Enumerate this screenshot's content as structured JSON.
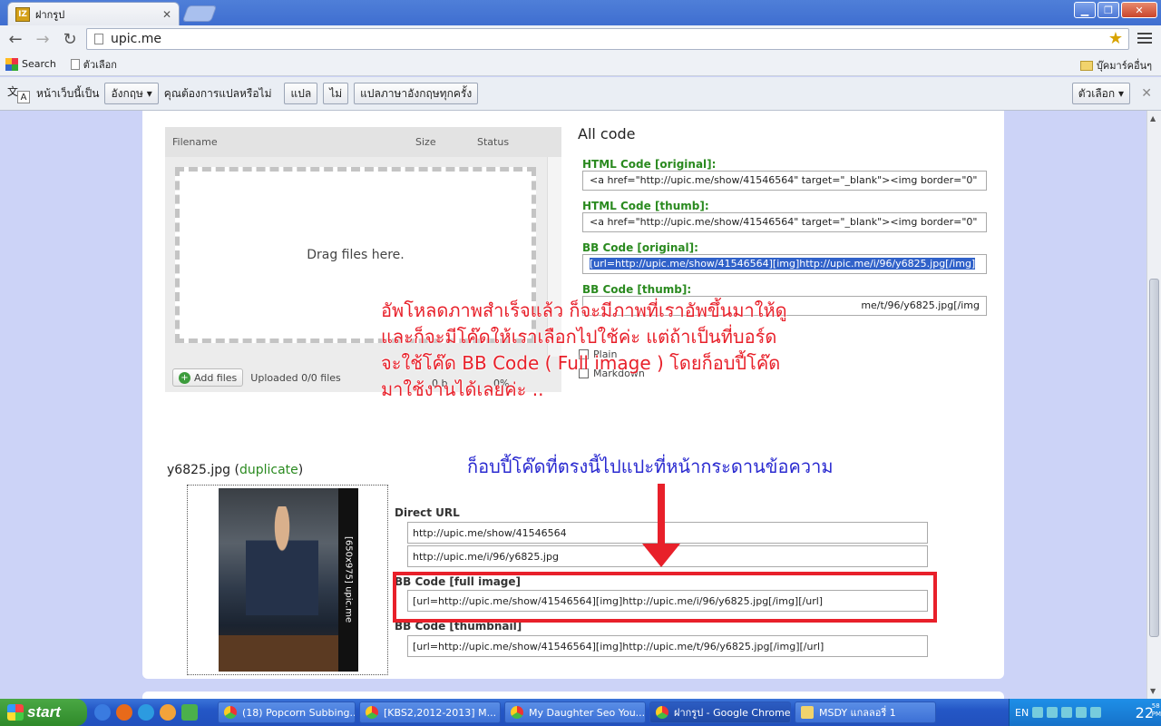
{
  "window": {
    "tab_title": "ฝากรูป",
    "favicon_text": "IZ"
  },
  "toolbar": {
    "url": "upic.me"
  },
  "bookmarks": {
    "search": "Search",
    "item2": "ตัวเลือก",
    "other_bookmarks": "บุ๊คมาร์คอื่นๆ"
  },
  "translate_bar": {
    "prefix": "หน้าเว็บนี้เป็น",
    "language": "อังกฤษ",
    "question": "คุณต้องการแปลหรือไม่",
    "translate": "แปล",
    "no": "ไม่",
    "always": "แปลภาษาอังกฤษทุกครั้ง",
    "options": "ตัวเลือก"
  },
  "uploader": {
    "col_filename": "Filename",
    "col_size": "Size",
    "col_status": "Status",
    "drop_text": "Drag files here.",
    "add_files": "Add files",
    "uploaded": "Uploaded 0/0 files",
    "size_total": "0 b",
    "percent": "0%"
  },
  "all_code": {
    "title": "All code",
    "html_original_label": "HTML Code [original]:",
    "html_original_value": "<a href=\"http://upic.me/show/41546564\" target=\"_blank\"><img border=\"0\"",
    "html_thumb_label": "HTML Code [thumb]:",
    "html_thumb_value": "<a href=\"http://upic.me/show/41546564\" target=\"_blank\"><img border=\"0\"",
    "bb_original_label": "BB Code [original]:",
    "bb_original_value": "[url=http://upic.me/show/41546564][img]http://upic.me/i/96/y6825.jpg[/img]",
    "bb_thumb_label": "BB Code [thumb]:",
    "bb_thumb_value": "me/t/96/y6825.jpg[/img",
    "opt_1": "Plain",
    "opt_2": "Markdown"
  },
  "file": {
    "name": "y6825.jpg",
    "status": "duplicate",
    "watermark": "[650x975] upic.me",
    "direct_url_label": "Direct URL",
    "show_url": "http://upic.me/show/41546564",
    "image_url": "http://upic.me/i/96/y6825.jpg",
    "bb_full_label": "BB Code [full image]",
    "bb_full_value": "[url=http://upic.me/show/41546564][img]http://upic.me/i/96/y6825.jpg[/img][/url]",
    "bb_thumb_label": "BB Code [thumbnail]",
    "bb_thumb_value": "[url=http://upic.me/show/41546564][img]http://upic.me/t/96/y6825.jpg[/img][/url]"
  },
  "annotations": {
    "red_note_lines": [
      "อัพโหลดภาพสำเร็จแล้ว ก็จะมีภาพที่เราอัพขึ้นมาให้ดู",
      "และก็จะมีโค๊ดให้เราเลือกไปใช้ค่ะ แต่ถ้าเป็นที่บอร์ด",
      "จะใช้โค๊ด BB Code ( Full image ) โดยก็อบปี้โค๊ด",
      "มาใช้งานได้เลยค่ะ .."
    ],
    "blue_note": "ก็อบปี้โค๊ดที่ตรงนี้ไปแปะที่หน้ากระดานข้อความ",
    "red_color": "#e8202a",
    "blue_color": "#2a2ad0"
  },
  "taskbar": {
    "start": "start",
    "tasks": [
      "(18) Popcorn Subbing...",
      "[KBS2,2012-2013] M...",
      "My Daughter Seo You...",
      "ฝากรูป - Google Chrome",
      "MSDY แกลลอรี่ 1"
    ],
    "lang": "EN",
    "time": "22",
    "time_suffix_1": "58",
    "time_suffix_2": "PM"
  }
}
